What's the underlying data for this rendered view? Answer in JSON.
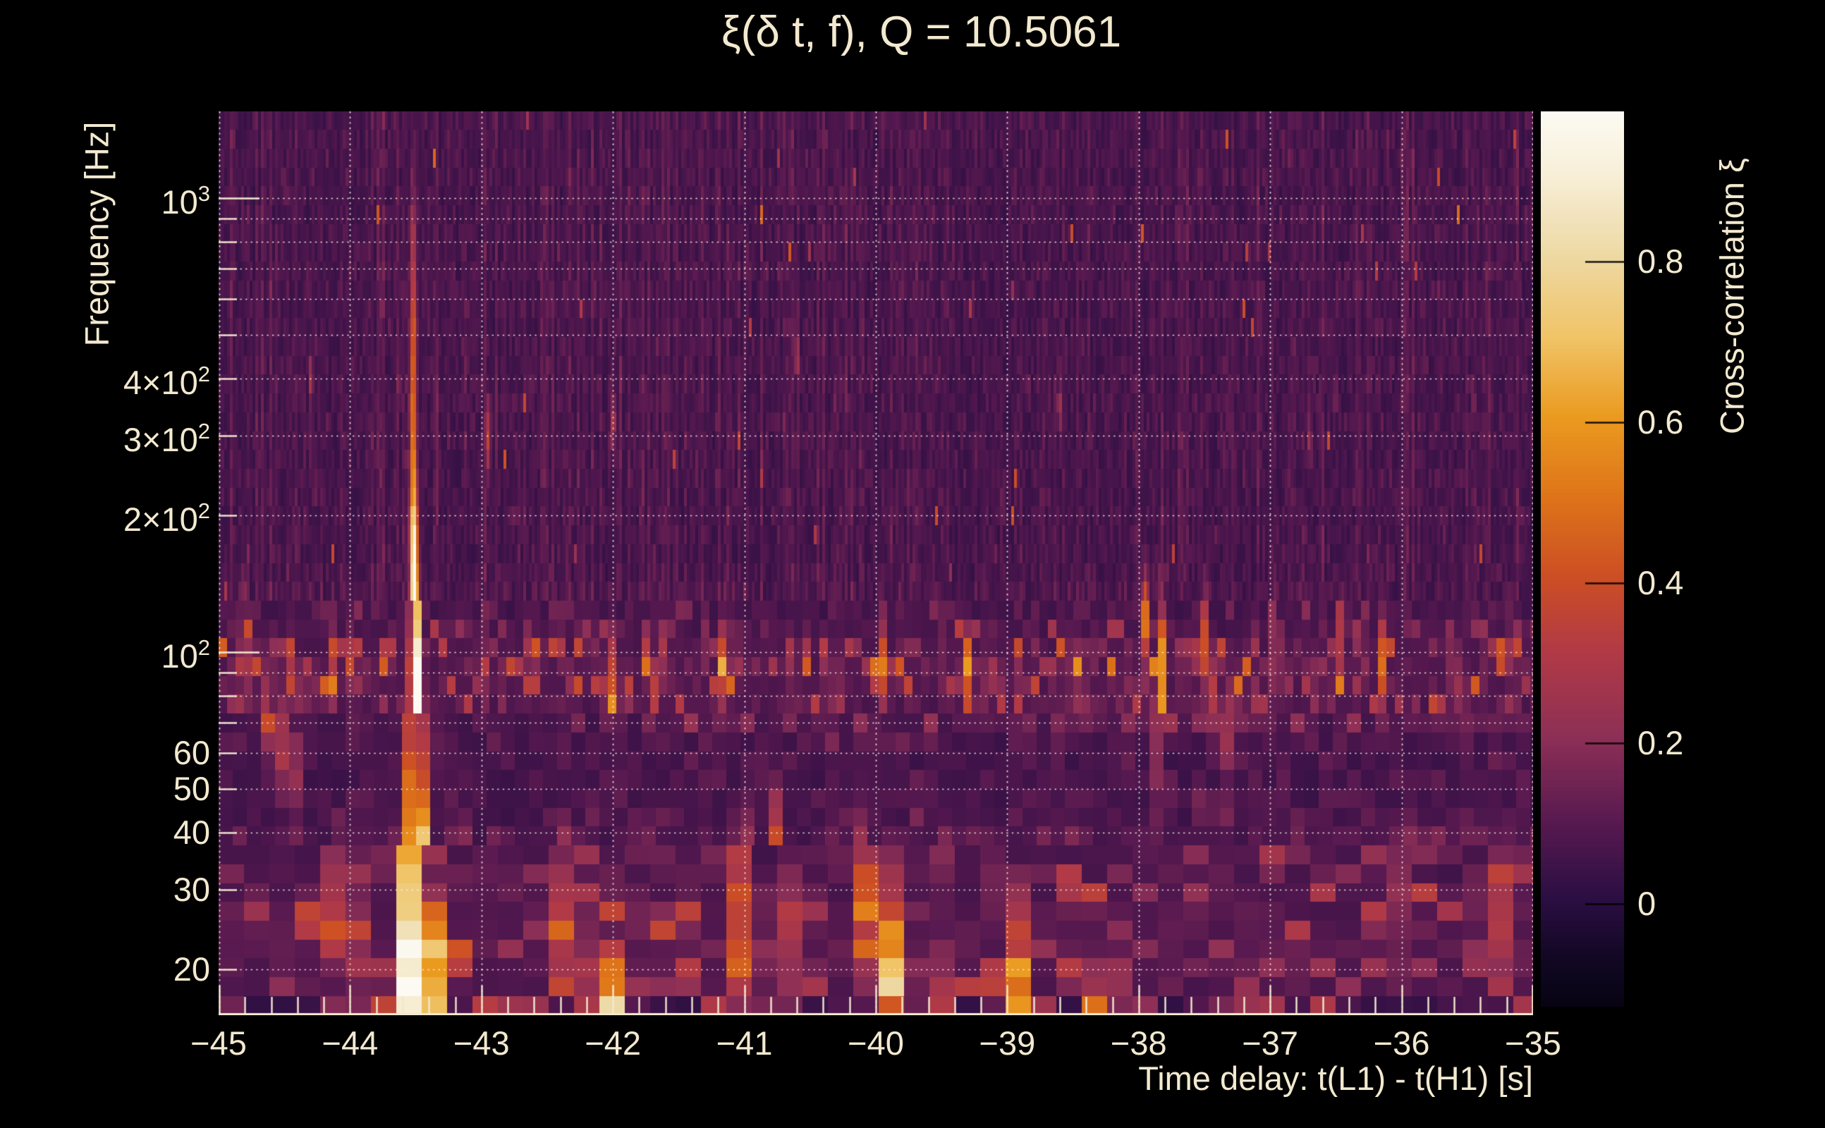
{
  "figure": {
    "background": "#000000",
    "text_color": "#f2e9cf"
  },
  "chart_data": {
    "type": "heatmap",
    "title": "ξ(δ t, f), Q = 10.5061",
    "xlabel": "Time delay: t(L1) - t(H1) [s]",
    "ylabel": "Frequency [Hz]",
    "colorbar_label": "Cross-correlation ξ",
    "x_range": [
      -45,
      -35
    ],
    "x_ticks": [
      -45,
      -44,
      -43,
      -42,
      -41,
      -40,
      -39,
      -38,
      -37,
      -36,
      -35
    ],
    "x_tick_labels": [
      "−45",
      "−44",
      "−43",
      "−42",
      "−41",
      "−40",
      "−39",
      "−38",
      "−37",
      "−36",
      "−35"
    ],
    "x_minor_tick_step": 0.2,
    "y_scale": "log",
    "y_range_hz": [
      15.86,
      1552
    ],
    "y_tick_labels": [
      {
        "base": "10",
        "exp": "3",
        "f": 1000
      },
      {
        "base": "4×10",
        "exp": "2",
        "f": 400
      },
      {
        "base": "3×10",
        "exp": "2",
        "f": 300
      },
      {
        "base": "2×10",
        "exp": "2",
        "f": 200
      },
      {
        "base": "10",
        "exp": "2",
        "f": 100
      },
      {
        "base": "60",
        "exp": "",
        "f": 60
      },
      {
        "base": "50",
        "exp": "",
        "f": 50
      },
      {
        "base": "40",
        "exp": "",
        "f": 40
      },
      {
        "base": "30",
        "exp": "",
        "f": 30
      },
      {
        "base": "20",
        "exp": "",
        "f": 20
      }
    ],
    "y_gridline_freqs": [
      20,
      30,
      40,
      50,
      60,
      70,
      80,
      90,
      100,
      200,
      300,
      400,
      500,
      600,
      700,
      800,
      900,
      1000
    ],
    "y_major_tick_freqs": [
      100,
      1000
    ],
    "z_range": [
      -0.128,
      0.987
    ],
    "z_ticks": [
      0.8,
      0.6,
      0.4,
      0.2,
      0
    ],
    "z_tick_labels": [
      "0.8",
      "0.6",
      "0.4",
      "0.2",
      "0"
    ],
    "grid": true,
    "grid_style": "dotted",
    "colormap_stops": [
      [
        0.0,
        "#060312"
      ],
      [
        0.06,
        "#140826"
      ],
      [
        0.12,
        "#2a0e42"
      ],
      [
        0.2,
        "#54184f"
      ],
      [
        0.3,
        "#8c2f56"
      ],
      [
        0.4,
        "#b23a45"
      ],
      [
        0.48,
        "#cc4e24"
      ],
      [
        0.57,
        "#de7419"
      ],
      [
        0.66,
        "#eb9b20"
      ],
      [
        0.75,
        "#f0c468"
      ],
      [
        0.84,
        "#eed9a4"
      ],
      [
        0.93,
        "#f7efd8"
      ],
      [
        1.0,
        "#fcfaf2"
      ]
    ],
    "noise": {
      "background_level": 0.05,
      "striation_strength": 0.065,
      "line_band": {
        "center_hz": 90,
        "width_log10": 0.08,
        "max_excess": 0.42
      },
      "low_band": {
        "center_hz": 23,
        "width_log10": 0.17,
        "max_excess": 0.3
      },
      "bottom_band_hz": 16.8
    },
    "features": [
      {
        "t": -43.52,
        "f": 330,
        "amp": 0.5,
        "dt": 0.016,
        "dlogf": 0.3
      },
      {
        "t": -43.51,
        "f": 140,
        "amp": 0.85,
        "dt": 0.02,
        "dlogf": 0.13
      },
      {
        "t": -43.5,
        "f": 80,
        "amp": 0.97,
        "dt": 0.026,
        "dlogf": 0.1
      },
      {
        "t": -43.5,
        "f": 50,
        "amp": 0.97,
        "dt": 0.035,
        "dlogf": 0.1
      },
      {
        "t": -43.49,
        "f": 32,
        "amp": 0.92,
        "dt": 0.05,
        "dlogf": 0.1
      },
      {
        "t": -43.48,
        "f": 21,
        "amp": 0.8,
        "dt": 0.09,
        "dlogf": 0.09
      },
      {
        "t": -43.47,
        "f": 16.5,
        "amp": 0.6,
        "dt": 0.13,
        "dlogf": 0.06
      },
      {
        "t": -44.8,
        "f": 100,
        "amp": 0.35,
        "dt": 0.018,
        "dlogf": 0.09
      },
      {
        "t": -44.62,
        "f": 75,
        "amp": 0.3,
        "dt": 0.022,
        "dlogf": 0.07
      },
      {
        "t": -44.5,
        "f": 62,
        "amp": 0.28,
        "dt": 0.02,
        "dlogf": 0.06
      },
      {
        "t": -44.43,
        "f": 55,
        "amp": 0.25,
        "dt": 0.018,
        "dlogf": 0.06
      },
      {
        "t": -44.3,
        "f": 400,
        "amp": 0.2,
        "dt": 0.01,
        "dlogf": 0.04
      },
      {
        "t": -44.15,
        "f": 90,
        "amp": 0.28,
        "dt": 0.018,
        "dlogf": 0.06
      },
      {
        "t": -44.0,
        "f": 24,
        "amp": 0.22,
        "dt": 0.06,
        "dlogf": 0.1
      },
      {
        "t": -43.0,
        "f": 92,
        "amp": 0.28,
        "dt": 0.018,
        "dlogf": 0.06
      },
      {
        "t": -42.95,
        "f": 300,
        "amp": 0.3,
        "dt": 0.013,
        "dlogf": 0.05
      },
      {
        "t": -42.62,
        "f": 95,
        "amp": 0.32,
        "dt": 0.018,
        "dlogf": 0.06
      },
      {
        "t": -42.35,
        "f": 26,
        "amp": 0.22,
        "dt": 0.07,
        "dlogf": 0.1
      },
      {
        "t": -42.05,
        "f": 16.5,
        "amp": 0.62,
        "dt": 0.09,
        "dlogf": 0.07
      },
      {
        "t": -42.02,
        "f": 90,
        "amp": 0.35,
        "dt": 0.02,
        "dlogf": 0.07
      },
      {
        "t": -42.0,
        "f": 320,
        "amp": 0.25,
        "dt": 0.012,
        "dlogf": 0.04
      },
      {
        "t": -41.6,
        "f": 100,
        "amp": 0.26,
        "dt": 0.018,
        "dlogf": 0.06
      },
      {
        "t": -41.15,
        "f": 92,
        "amp": 0.4,
        "dt": 0.022,
        "dlogf": 0.07
      },
      {
        "t": -41.0,
        "f": 30,
        "amp": 0.3,
        "dt": 0.05,
        "dlogf": 0.1
      },
      {
        "t": -40.97,
        "f": 19,
        "amp": 0.5,
        "dt": 0.05,
        "dlogf": 0.12
      },
      {
        "t": -40.75,
        "f": 33,
        "amp": 0.45,
        "dt": 0.03,
        "dlogf": 0.1
      },
      {
        "t": -40.72,
        "f": 24,
        "amp": 0.42,
        "dt": 0.045,
        "dlogf": 0.1
      },
      {
        "t": -40.6,
        "f": 450,
        "amp": 0.22,
        "dt": 0.01,
        "dlogf": 0.04
      },
      {
        "t": -40.3,
        "f": 88,
        "amp": 0.3,
        "dt": 0.018,
        "dlogf": 0.06
      },
      {
        "t": -40.1,
        "f": 28,
        "amp": 0.3,
        "dt": 0.05,
        "dlogf": 0.1
      },
      {
        "t": -39.95,
        "f": 95,
        "amp": 0.3,
        "dt": 0.018,
        "dlogf": 0.06
      },
      {
        "t": -39.87,
        "f": 20,
        "amp": 0.5,
        "dt": 0.055,
        "dlogf": 0.13
      },
      {
        "t": -39.3,
        "f": 88,
        "amp": 0.35,
        "dt": 0.02,
        "dlogf": 0.07
      },
      {
        "t": -38.92,
        "f": 18,
        "amp": 0.4,
        "dt": 0.05,
        "dlogf": 0.09
      },
      {
        "t": -38.9,
        "f": 65,
        "amp": 0.3,
        "dt": 0.02,
        "dlogf": 0.06
      },
      {
        "t": -38.6,
        "f": 350,
        "amp": 0.22,
        "dt": 0.01,
        "dlogf": 0.04
      },
      {
        "t": -38.5,
        "f": 95,
        "amp": 0.3,
        "dt": 0.018,
        "dlogf": 0.06
      },
      {
        "t": -38.25,
        "f": 16.5,
        "amp": 0.45,
        "dt": 0.07,
        "dlogf": 0.07
      },
      {
        "t": -37.95,
        "f": 120,
        "amp": 0.42,
        "dt": 0.018,
        "dlogf": 0.07
      },
      {
        "t": -37.83,
        "f": 75,
        "amp": 0.55,
        "dt": 0.022,
        "dlogf": 0.14
      },
      {
        "t": -37.49,
        "f": 108,
        "amp": 0.4,
        "dt": 0.016,
        "dlogf": 0.07
      },
      {
        "t": -37.42,
        "f": 80,
        "amp": 0.35,
        "dt": 0.018,
        "dlogf": 0.06
      },
      {
        "t": -37.31,
        "f": 65,
        "amp": 0.3,
        "dt": 0.02,
        "dlogf": 0.06
      },
      {
        "t": -36.96,
        "f": 105,
        "amp": 0.35,
        "dt": 0.016,
        "dlogf": 0.06
      },
      {
        "t": -36.7,
        "f": 300,
        "amp": 0.2,
        "dt": 0.01,
        "dlogf": 0.04
      },
      {
        "t": -36.46,
        "f": 108,
        "amp": 0.3,
        "dt": 0.015,
        "dlogf": 0.06
      },
      {
        "t": -36.15,
        "f": 95,
        "amp": 0.35,
        "dt": 0.02,
        "dlogf": 0.07
      },
      {
        "t": -35.95,
        "f": 30,
        "amp": 0.28,
        "dt": 0.05,
        "dlogf": 0.09
      },
      {
        "t": -35.6,
        "f": 88,
        "amp": 0.33,
        "dt": 0.02,
        "dlogf": 0.06
      },
      {
        "t": -35.3,
        "f": 25,
        "amp": 0.38,
        "dt": 0.05,
        "dlogf": 0.1
      },
      {
        "t": -35.15,
        "f": 90,
        "amp": 0.3,
        "dt": 0.016,
        "dlogf": 0.06
      }
    ]
  }
}
